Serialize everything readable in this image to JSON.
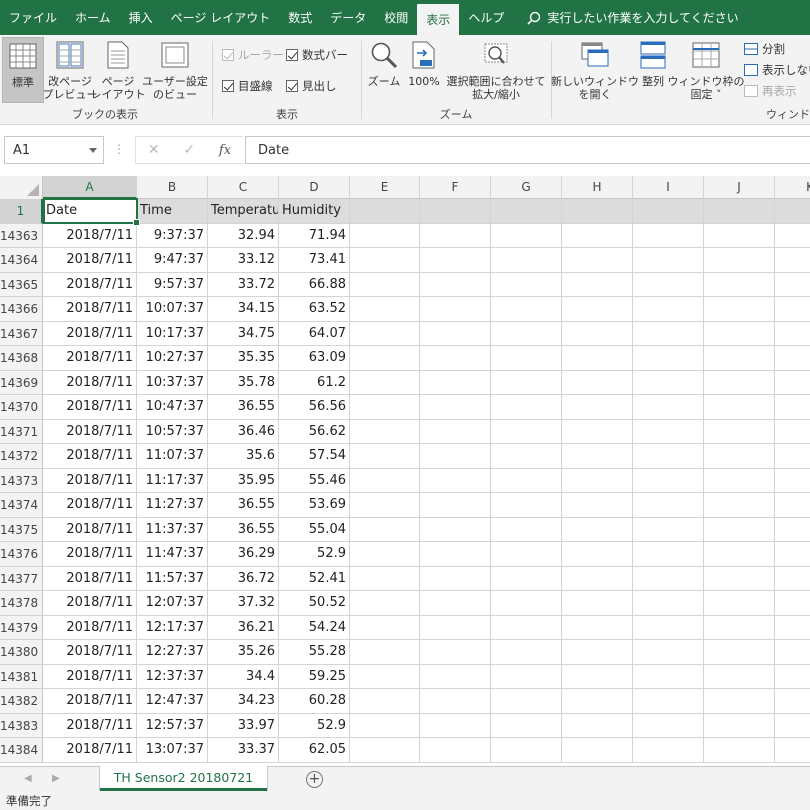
{
  "ribbon_tabs": [
    {
      "label": "ファイル",
      "active": false
    },
    {
      "label": "ホーム",
      "active": false
    },
    {
      "label": "挿入",
      "active": false
    },
    {
      "label": "ページ レイアウト",
      "active": false
    },
    {
      "label": "数式",
      "active": false
    },
    {
      "label": "データ",
      "active": false
    },
    {
      "label": "校閲",
      "active": false
    },
    {
      "label": "表示",
      "active": true
    },
    {
      "label": "ヘルプ",
      "active": false
    }
  ],
  "tell_me": {
    "text": "実行したい作業を入力してください",
    "icon": "search-icon"
  },
  "ribbon": {
    "workbook_views": {
      "label": "ブックの表示",
      "normal": "標準",
      "page_break_l1": "改ページ",
      "page_break_l2": "プレビュー",
      "page_layout_l1": "ページ",
      "page_layout_l2": "レイアウト",
      "custom_l1": "ユーザー設定",
      "custom_l2": "のビュー"
    },
    "show": {
      "label": "表示",
      "ruler": "ルーラー",
      "formula_bar": "数式バー",
      "gridlines": "目盛線",
      "headings": "見出し"
    },
    "zoom": {
      "label": "ズーム",
      "zoom": "ズーム",
      "hundred": "100%",
      "fit_l1": "選択範囲に合わせて",
      "fit_l2": "拡大/縮小"
    },
    "window": {
      "label": "ウィンド",
      "new_window_l1": "新しいウィンドウ",
      "new_window_l2": "を開く",
      "arrange": "整列",
      "freeze_l1": "ウィンドウ枠の",
      "freeze_l2": "固定 ˅",
      "split": "分割",
      "hide": "表示しない",
      "unhide": "再表示"
    }
  },
  "formula_bar": {
    "name_box": "A1",
    "formula": "Date",
    "fx": "fx",
    "cancel": "✕",
    "enter": "✓"
  },
  "columns": [
    "A",
    "B",
    "C",
    "D",
    "E",
    "F",
    "G",
    "H",
    "I",
    "J",
    "K"
  ],
  "header_row": {
    "row_number": "1",
    "cells": [
      "Date",
      "Time",
      "Temperature",
      "Humidity"
    ]
  },
  "rows": [
    {
      "n": "14363",
      "date": "2018/7/11",
      "time": "9:37:37",
      "temp": "32.94",
      "hum": "71.94"
    },
    {
      "n": "14364",
      "date": "2018/7/11",
      "time": "9:47:37",
      "temp": "33.12",
      "hum": "73.41"
    },
    {
      "n": "14365",
      "date": "2018/7/11",
      "time": "9:57:37",
      "temp": "33.72",
      "hum": "66.88"
    },
    {
      "n": "14366",
      "date": "2018/7/11",
      "time": "10:07:37",
      "temp": "34.15",
      "hum": "63.52"
    },
    {
      "n": "14367",
      "date": "2018/7/11",
      "time": "10:17:37",
      "temp": "34.75",
      "hum": "64.07"
    },
    {
      "n": "14368",
      "date": "2018/7/11",
      "time": "10:27:37",
      "temp": "35.35",
      "hum": "63.09"
    },
    {
      "n": "14369",
      "date": "2018/7/11",
      "time": "10:37:37",
      "temp": "35.78",
      "hum": "61.2"
    },
    {
      "n": "14370",
      "date": "2018/7/11",
      "time": "10:47:37",
      "temp": "36.55",
      "hum": "56.56"
    },
    {
      "n": "14371",
      "date": "2018/7/11",
      "time": "10:57:37",
      "temp": "36.46",
      "hum": "56.62"
    },
    {
      "n": "14372",
      "date": "2018/7/11",
      "time": "11:07:37",
      "temp": "35.6",
      "hum": "57.54"
    },
    {
      "n": "14373",
      "date": "2018/7/11",
      "time": "11:17:37",
      "temp": "35.95",
      "hum": "55.46"
    },
    {
      "n": "14374",
      "date": "2018/7/11",
      "time": "11:27:37",
      "temp": "36.55",
      "hum": "53.69"
    },
    {
      "n": "14375",
      "date": "2018/7/11",
      "time": "11:37:37",
      "temp": "36.55",
      "hum": "55.04"
    },
    {
      "n": "14376",
      "date": "2018/7/11",
      "time": "11:47:37",
      "temp": "36.29",
      "hum": "52.9"
    },
    {
      "n": "14377",
      "date": "2018/7/11",
      "time": "11:57:37",
      "temp": "36.72",
      "hum": "52.41"
    },
    {
      "n": "14378",
      "date": "2018/7/11",
      "time": "12:07:37",
      "temp": "37.32",
      "hum": "50.52"
    },
    {
      "n": "14379",
      "date": "2018/7/11",
      "time": "12:17:37",
      "temp": "36.21",
      "hum": "54.24"
    },
    {
      "n": "14380",
      "date": "2018/7/11",
      "time": "12:27:37",
      "temp": "35.26",
      "hum": "55.28"
    },
    {
      "n": "14381",
      "date": "2018/7/11",
      "time": "12:37:37",
      "temp": "34.4",
      "hum": "59.25"
    },
    {
      "n": "14382",
      "date": "2018/7/11",
      "time": "12:47:37",
      "temp": "34.23",
      "hum": "60.28"
    },
    {
      "n": "14383",
      "date": "2018/7/11",
      "time": "12:57:37",
      "temp": "33.97",
      "hum": "52.9"
    },
    {
      "n": "14384",
      "date": "2018/7/11",
      "time": "13:07:37",
      "temp": "33.37",
      "hum": "62.05"
    }
  ],
  "sheet_tab": {
    "label": "TH Sensor2 20180721",
    "add_label": "+"
  },
  "status": {
    "text": "準備完了"
  },
  "colors": {
    "accent": "#217346",
    "ribbon_bg": "#f3f3f3"
  }
}
